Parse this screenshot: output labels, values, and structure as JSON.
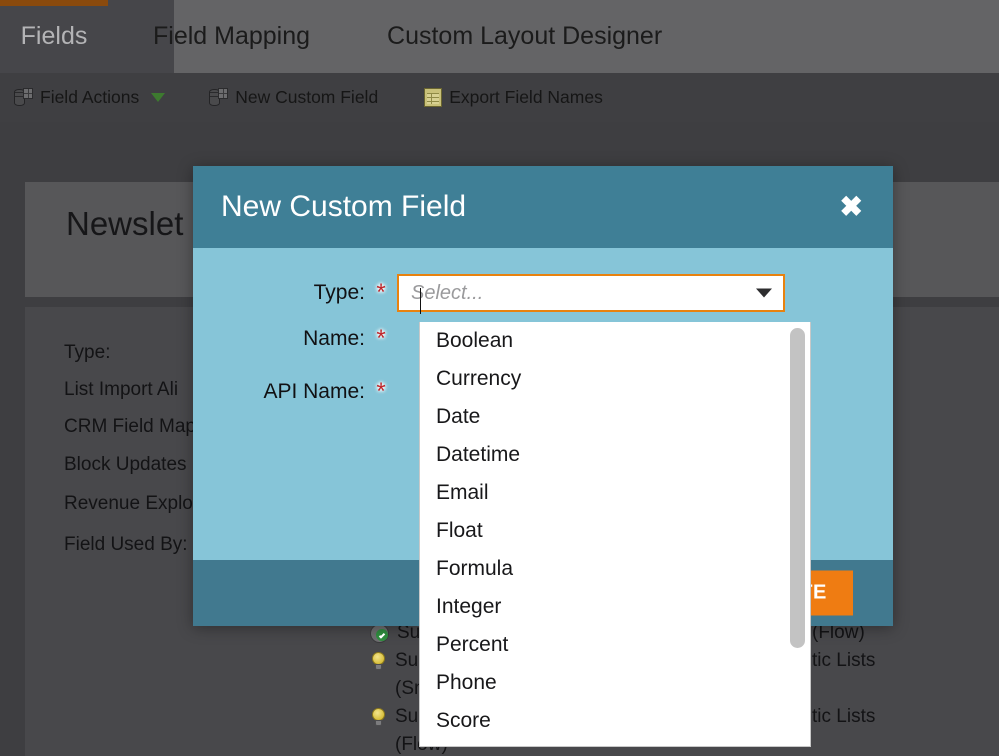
{
  "tabs": [
    {
      "label": "Fields",
      "active": true
    },
    {
      "label": "Field Mapping",
      "active": false
    },
    {
      "label": "Custom Layout Designer",
      "active": false
    }
  ],
  "toolbar": {
    "field_actions": "Field Actions",
    "new_custom_field": "New Custom Field",
    "export_field_names": "Export Field Names"
  },
  "background": {
    "panel_title": "Newslet",
    "detail_labels": [
      "Type:",
      "List Import Ali",
      "CRM Field Map",
      "Block Updates",
      "Revenue Explo",
      "Field Used By:"
    ],
    "usage_rows": [
      {
        "icon": "check-circle-icon",
        "text": "Su"
      },
      {
        "icon": "lightbulb-icon",
        "text": "Su"
      },
      {
        "icon": "none",
        "text": "(Sm"
      },
      {
        "icon": "lightbulb-icon",
        "text": "Su"
      },
      {
        "icon": "none",
        "text": "(Flow)"
      }
    ],
    "right_fragments": [
      "(Flow)",
      "tic Lists",
      "tic Lists"
    ]
  },
  "modal": {
    "title": "New Custom Field",
    "close_label": "✖",
    "fields": [
      {
        "label": "Type:",
        "required": "*"
      },
      {
        "label": "Name:",
        "required": "*"
      },
      {
        "label": "API Name:",
        "required": "*"
      }
    ],
    "type_select": {
      "placeholder": "Select...",
      "value": "",
      "options": [
        "Boolean",
        "Currency",
        "Date",
        "Datetime",
        "Email",
        "Float",
        "Formula",
        "Integer",
        "Percent",
        "Phone",
        "Score"
      ]
    },
    "create_button": "ATE"
  },
  "colors": {
    "accent_orange": "#ef7c12",
    "modal_header_teal": "#3f7f96",
    "modal_body_blue": "#86c5d8",
    "modal_footer_teal": "#41798f",
    "required_red": "#c0282d",
    "focus_border": "#e8820f"
  }
}
